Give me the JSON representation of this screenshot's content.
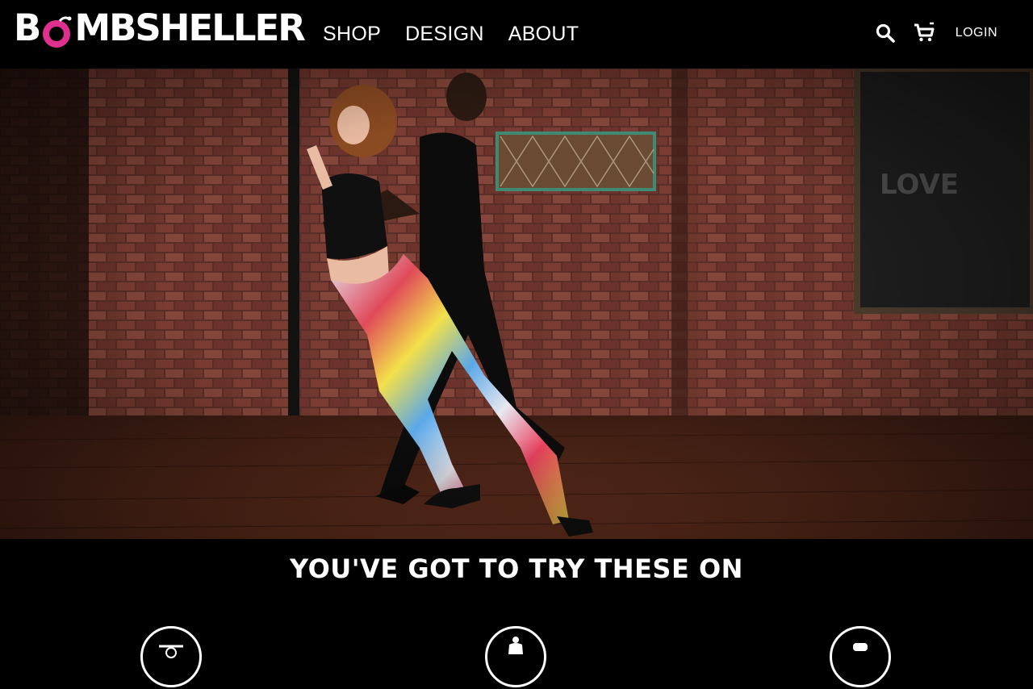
{
  "brand": {
    "logo_pre": "B",
    "logo_post": "MBSHELLER",
    "accent_color": "#e0308f"
  },
  "nav": {
    "items": [
      {
        "label": "SHOP"
      },
      {
        "label": "DESIGN"
      },
      {
        "label": "ABOUT"
      }
    ]
  },
  "tools": {
    "search_icon": "search-icon",
    "cart_icon": "cart-icon",
    "login_label": "LOGIN"
  },
  "hero": {
    "alt": "Dancers in a brick-walled studio; woman wearing colorful patterned leggings"
  },
  "section": {
    "title": "YOU'VE GOT TO TRY THESE ON"
  },
  "features": [
    {
      "icon": "dial-icon"
    },
    {
      "icon": "dress-form-icon"
    },
    {
      "icon": "circle-icon"
    }
  ]
}
